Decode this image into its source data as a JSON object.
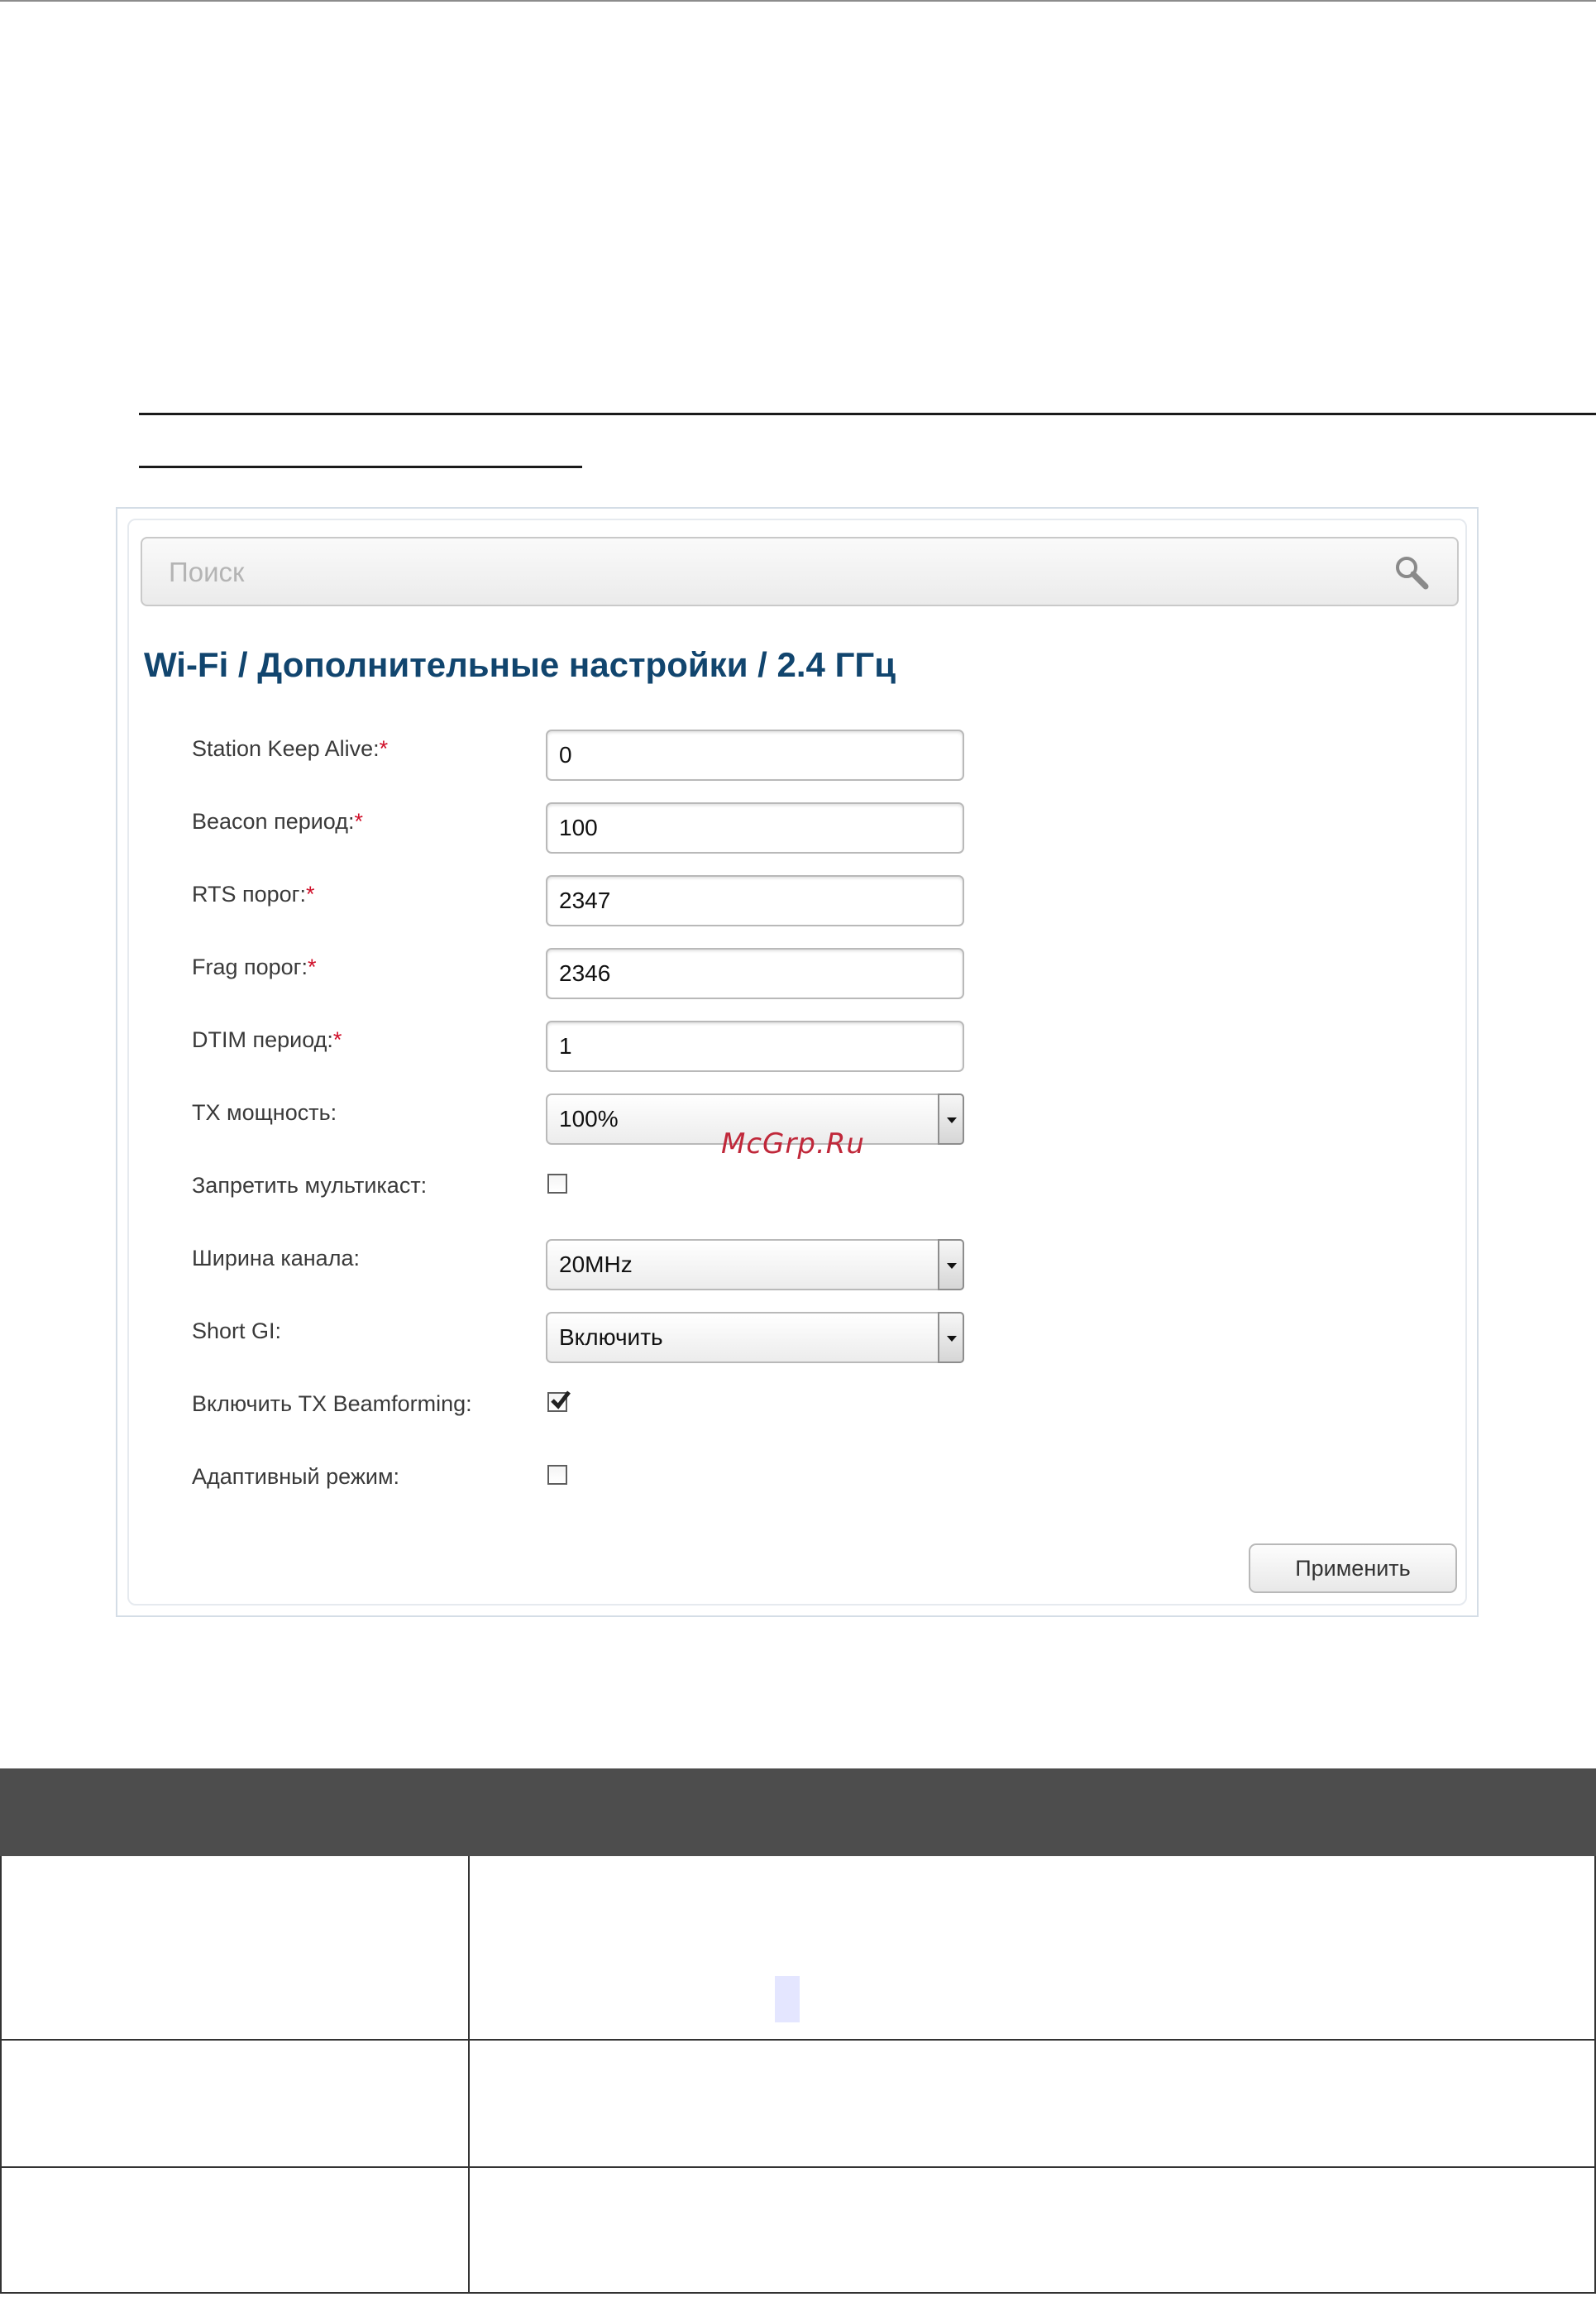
{
  "search": {
    "placeholder": "Поиск"
  },
  "breadcrumb": {
    "part1": "Wi-Fi /",
    "part2": "Дополнительные настройки /",
    "part3": "2.4 ГГц"
  },
  "fields": [
    {
      "label": "Station Keep Alive:",
      "required": "*",
      "value": "0"
    },
    {
      "label": "Beacon период:",
      "required": "*",
      "value": "100"
    },
    {
      "label": "RTS порог:",
      "required": "*",
      "value": "2347"
    },
    {
      "label": "Frag порог:",
      "required": "*",
      "value": "2346"
    },
    {
      "label": "DTIM период:",
      "required": "*",
      "value": "1"
    },
    {
      "label": "TX мощность:",
      "value": "100%"
    },
    {
      "label": "Запретить мультикаст:",
      "checked": false
    },
    {
      "label": "Ширина канала:",
      "value": "20MHz"
    },
    {
      "label": "Short GI:",
      "value": "Включить"
    },
    {
      "label": "Включить TX Beamforming:",
      "checked": true
    },
    {
      "label": "Адаптивный режим:",
      "checked": false
    }
  ],
  "apply_label": "Применить",
  "watermark": "McGrp.Ru",
  "colors": {
    "title": "#11456e",
    "required": "#d0102a",
    "table_header": "#4d4d4d",
    "watermark": "#c0283a"
  }
}
